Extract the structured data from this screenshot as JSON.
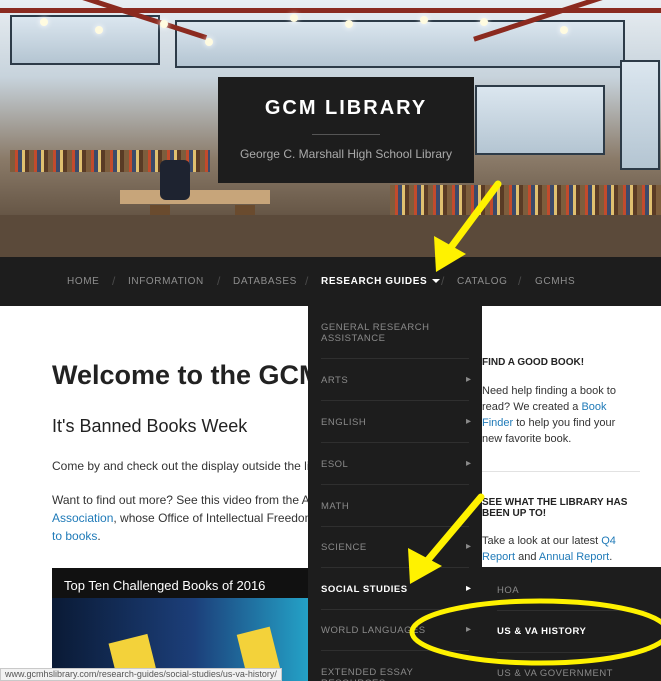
{
  "site": {
    "title": "GCM LIBRARY",
    "tagline": "George C. Marshall High School Library"
  },
  "nav": {
    "items": [
      {
        "label": "HOME",
        "active": false
      },
      {
        "label": "INFORMATION",
        "active": false
      },
      {
        "label": "DATABASES",
        "active": false
      },
      {
        "label": "RESEARCH GUIDES",
        "active": true
      },
      {
        "label": "CATALOG",
        "active": false
      },
      {
        "label": "GCMHS",
        "active": false
      }
    ],
    "separator": "/"
  },
  "dropdown": {
    "items": [
      {
        "label": "GENERAL RESEARCH ASSISTANCE",
        "has_submenu": false
      },
      {
        "label": "ARTS",
        "has_submenu": true
      },
      {
        "label": "ENGLISH",
        "has_submenu": true
      },
      {
        "label": "ESOL",
        "has_submenu": true
      },
      {
        "label": "MATH",
        "has_submenu": false
      },
      {
        "label": "SCIENCE",
        "has_submenu": true
      },
      {
        "label": "SOCIAL STUDIES",
        "has_submenu": true
      },
      {
        "label": "WORLD LANGUAGES",
        "has_submenu": true
      },
      {
        "label": "EXTENDED ESSAY RESOURCES",
        "has_submenu": false
      }
    ]
  },
  "submenu": {
    "items": [
      {
        "label": "HOA"
      },
      {
        "label": "US & VA HISTORY"
      },
      {
        "label": "US & VA GOVERNMENT"
      }
    ]
  },
  "main": {
    "page_title": "Welcome to the GCM Library",
    "subhead": "It's Banned Books Week",
    "para1": "Come by and check out the display outside the library!",
    "para2_line1": "Want to find out more? See this video from the American Library",
    "para2_link1": "Association",
    "para2_line2_rest": ", whose Office of Intellectual Freedom tracks challenges",
    "para2_link2": "to books",
    "para2_end": ".",
    "video_title": "Top Ten Challenged Books of 2016"
  },
  "sidebar": {
    "heading1": "FIND A GOOD BOOK!",
    "p1_line1": "Need help finding a book to",
    "p1_line2_pre": "read? We created a ",
    "p1_link": "Book",
    "p1_link2": "Finder",
    "p1_line3_rest": " to help you find your",
    "p1_line4": "new favorite book.",
    "heading2_line1": "SEE WHAT THE LIBRARY HAS",
    "heading2_line2": "BEEN UP TO!",
    "p2_line1_pre": "Take a look at our latest ",
    "p2_link1": "Q4",
    "p2_link1b": "Report",
    "p2_mid": " and ",
    "p2_link2": "Annual Report",
    "p2_end": "."
  },
  "status_url": "www.gcmhslibrary.com/research-guides/social-studies/us-va-history/",
  "colors": {
    "nav_bg": "#1d1d1d",
    "link": "#1f7ab8",
    "annotation": "#fff200"
  }
}
